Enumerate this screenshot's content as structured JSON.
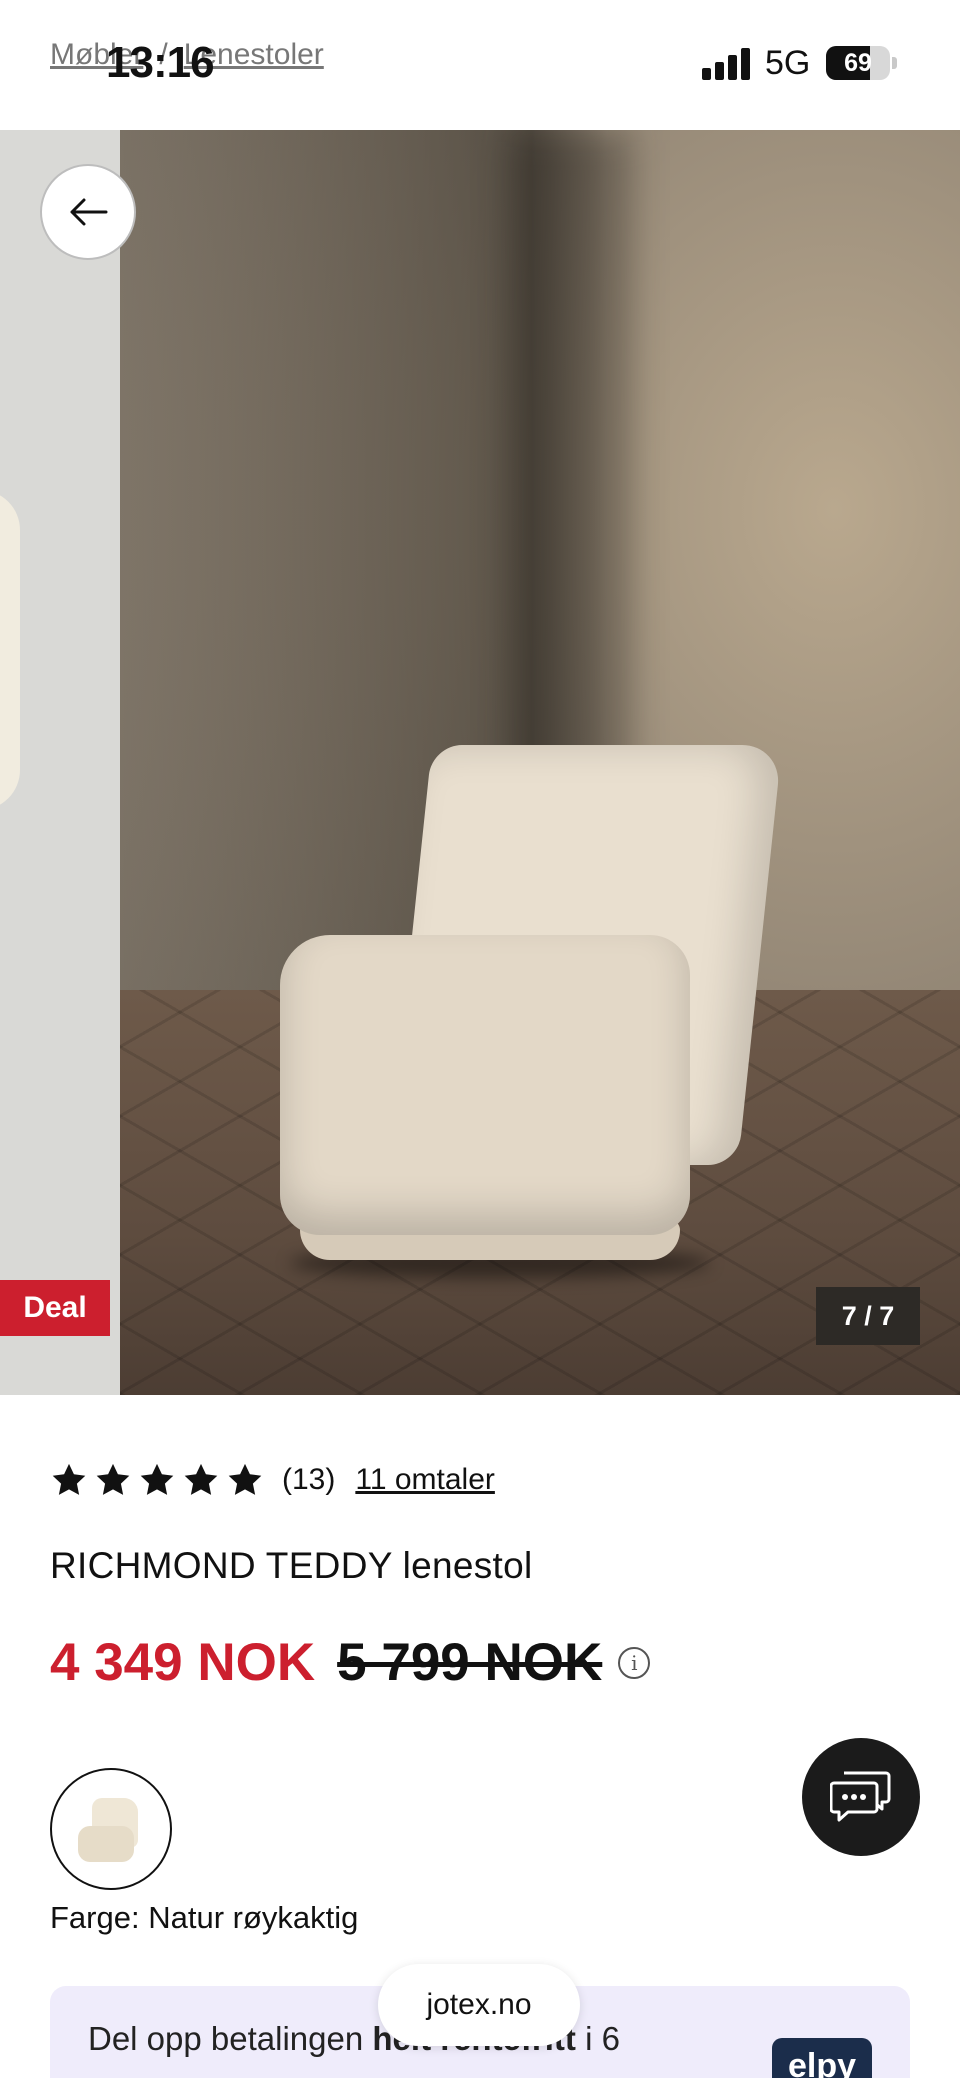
{
  "status_bar": {
    "time": "13:16",
    "network": "5G",
    "battery": "69",
    "battery_level": 0.69
  },
  "breadcrumb": {
    "items": [
      "Møbler",
      "Lenestoler"
    ],
    "separator": "/"
  },
  "gallery": {
    "badge": "Deal",
    "counter": "7 / 7"
  },
  "product": {
    "rating_stars": 5,
    "rating_count": "(13)",
    "reviews_link": "11 omtaler",
    "title": "RICHMOND TEDDY lenestol",
    "price_current": "4 349 NOK",
    "price_original": "5 799 NOK",
    "info_icon": "i",
    "color_label": "Farge: Natur røykaktig"
  },
  "promo": {
    "text_before": "Del opp betalingen ",
    "text_bold": "helt rentefritt",
    "text_after": " i 6",
    "logo": "elpy"
  },
  "browser": {
    "url": "jotex.no"
  },
  "colors": {
    "accent": "#cc1f2e",
    "dark": "#1b1b1b",
    "promo_bg": "#efecfb"
  }
}
